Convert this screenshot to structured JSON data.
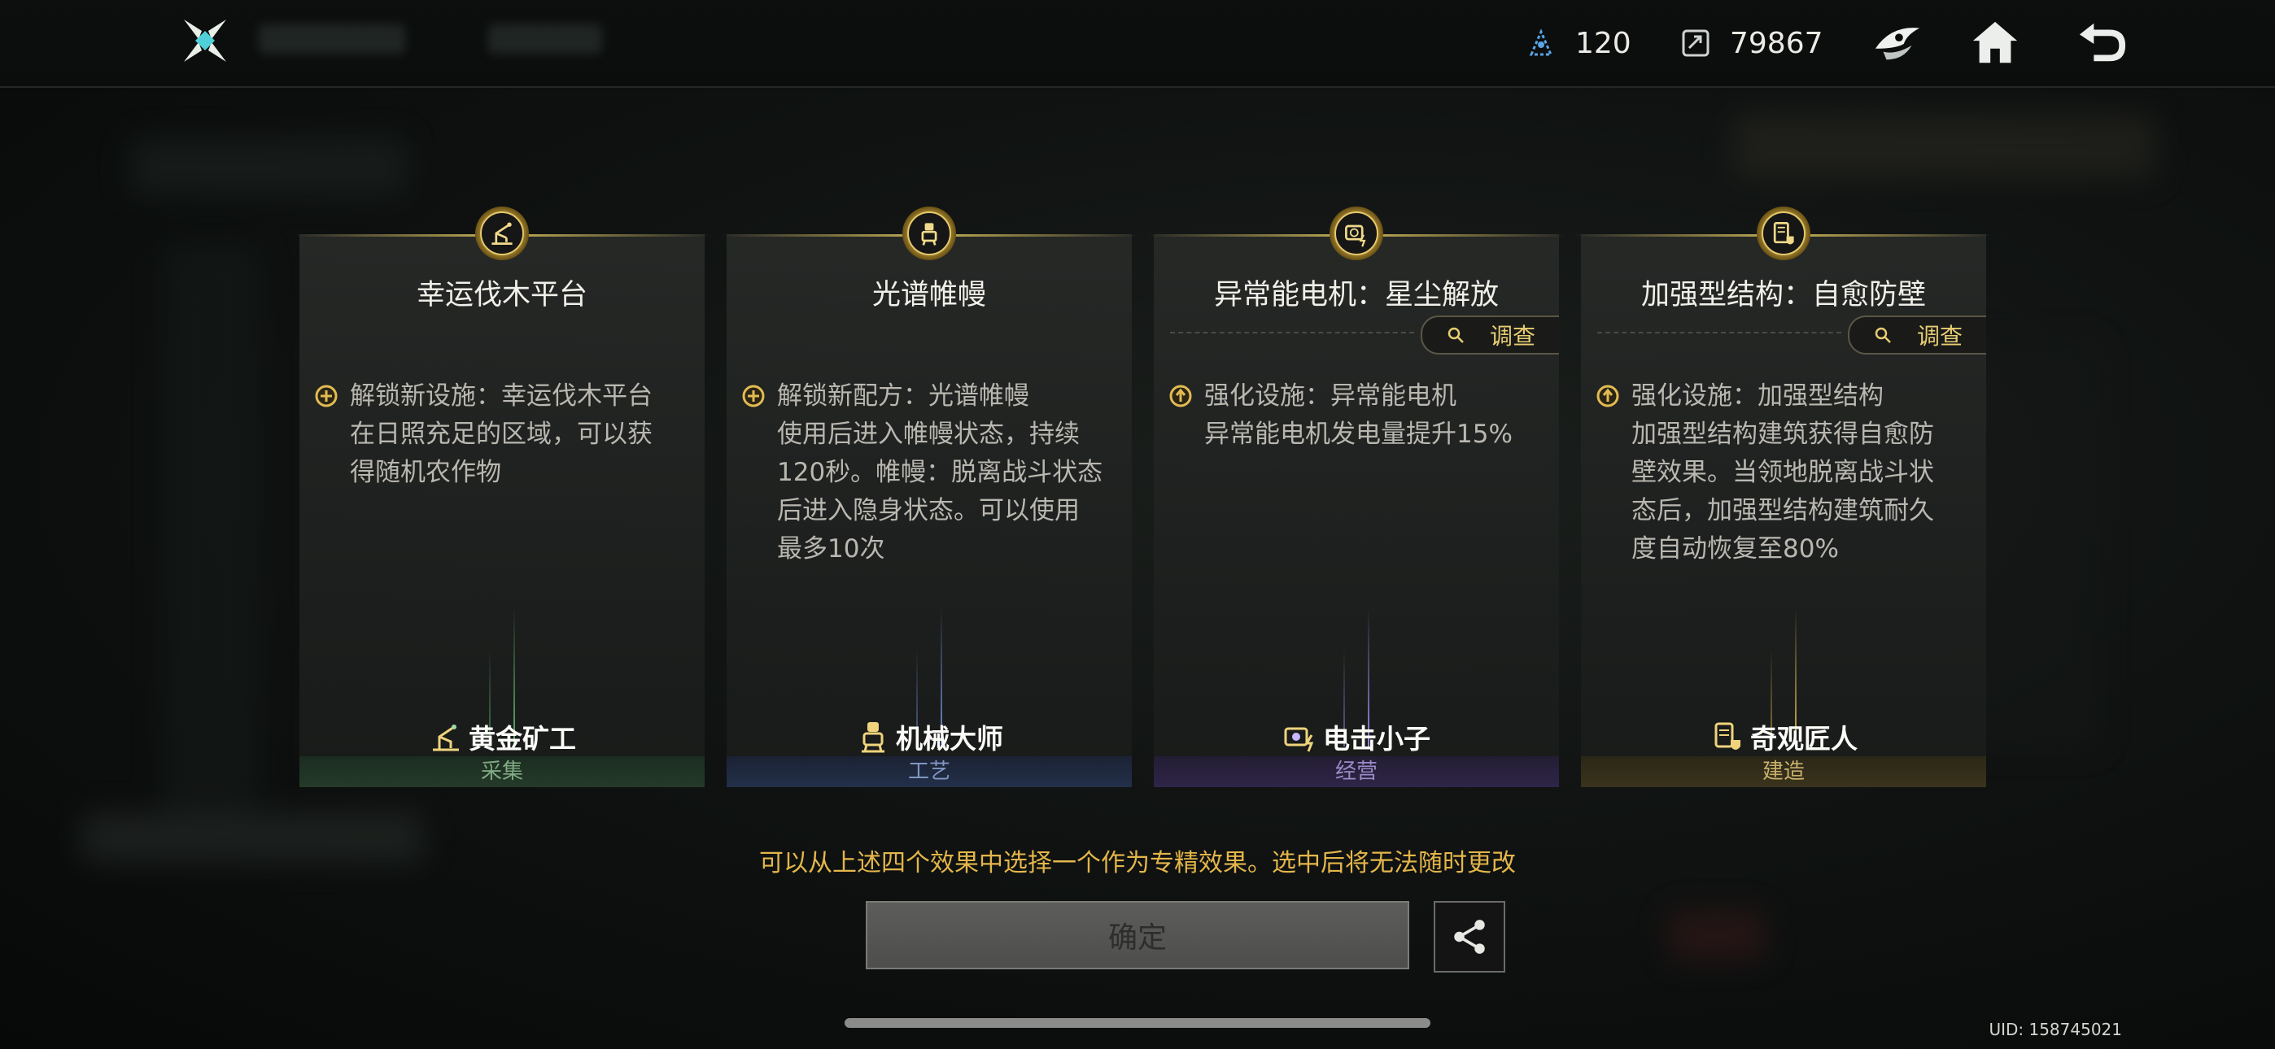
{
  "header": {
    "currencies": [
      {
        "icon": "energy-crystal-icon",
        "value": "120"
      },
      {
        "icon": "ticket-coin-icon",
        "value": "79867"
      }
    ],
    "icons": [
      "guild-emblem-icon",
      "home-icon",
      "back-icon"
    ]
  },
  "cards": [
    {
      "title": "幸运伐木平台",
      "investigate": null,
      "effect_icon": "unlock-plus-icon",
      "desc_line1": "解锁新设施：幸运伐木平台",
      "desc_rest": "在日照充足的区域，可以获\n得随机农作物",
      "role": "黄金矿工",
      "category": "采集",
      "color": "#5fb36b"
    },
    {
      "title": "光谱帷幔",
      "investigate": null,
      "effect_icon": "unlock-plus-icon",
      "desc_line1": "解锁新配方：光谱帷幔",
      "desc_rest": "使用后进入帷幔状态，持续\n120秒。帷幔：脱离战斗状态\n后进入隐身状态。可以使用\n最多10次",
      "role": "机械大师",
      "category": "工艺",
      "color": "#6f8fd6"
    },
    {
      "title": "异常能电机：星尘解放",
      "investigate": "调查",
      "effect_icon": "upgrade-arrow-icon",
      "desc_line1": "强化设施：异常能电机",
      "desc_rest": "异常能电机发电量提升15%",
      "role": "电击小子",
      "category": "经营",
      "color": "#9b86e0"
    },
    {
      "title": "加强型结构：自愈防壁",
      "investigate": "调查",
      "effect_icon": "upgrade-arrow-icon",
      "desc_line1": "强化设施：加强型结构",
      "desc_rest": "加强型结构建筑获得自愈防\n壁效果。当领地脱离战斗状\n态后，加强型结构建筑耐久\n度自动恢复至80%",
      "role": "奇观匠人",
      "category": "建造",
      "color": "#d9b14a"
    }
  ],
  "hint": "可以从上述四个效果中选择一个作为专精效果。选中后将无法随时更改",
  "confirm_label": "确定",
  "uid": "UID: 158745021",
  "accent": "#e4b64a"
}
